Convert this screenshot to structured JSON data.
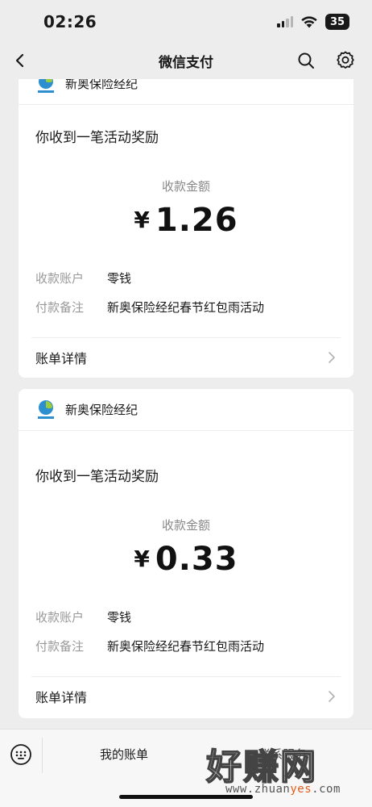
{
  "status_bar": {
    "time": "02:26",
    "battery": "35"
  },
  "nav": {
    "title": "微信支付"
  },
  "cards": [
    {
      "merchant": "新奥保险经纪",
      "headline": "你收到一笔活动奖励",
      "amount_label": "收款金额",
      "currency": "¥",
      "amount": "1.26",
      "rows": [
        {
          "key": "收款账户",
          "value": "零钱"
        },
        {
          "key": "付款备注",
          "value": "新奥保险经纪春节红包雨活动"
        }
      ],
      "detail_link": "账单详情"
    },
    {
      "merchant": "新奥保险经纪",
      "headline": "你收到一笔活动奖励",
      "amount_label": "收款金额",
      "currency": "¥",
      "amount": "0.33",
      "rows": [
        {
          "key": "收款账户",
          "value": "零钱"
        },
        {
          "key": "付款备注",
          "value": "新奥保险经纪春节红包雨活动"
        }
      ],
      "detail_link": "账单详情"
    }
  ],
  "tab_bar": {
    "bills": "我的账单",
    "service": "联系服务"
  },
  "watermark": {
    "text": "好赚网",
    "url_start": "www.zhuan",
    "url_mid": "yes",
    "url_end": ".com"
  },
  "colors": {
    "background": "#ededed",
    "card": "#ffffff",
    "muted": "#999999",
    "watermark_accent": "#e05d1b"
  }
}
